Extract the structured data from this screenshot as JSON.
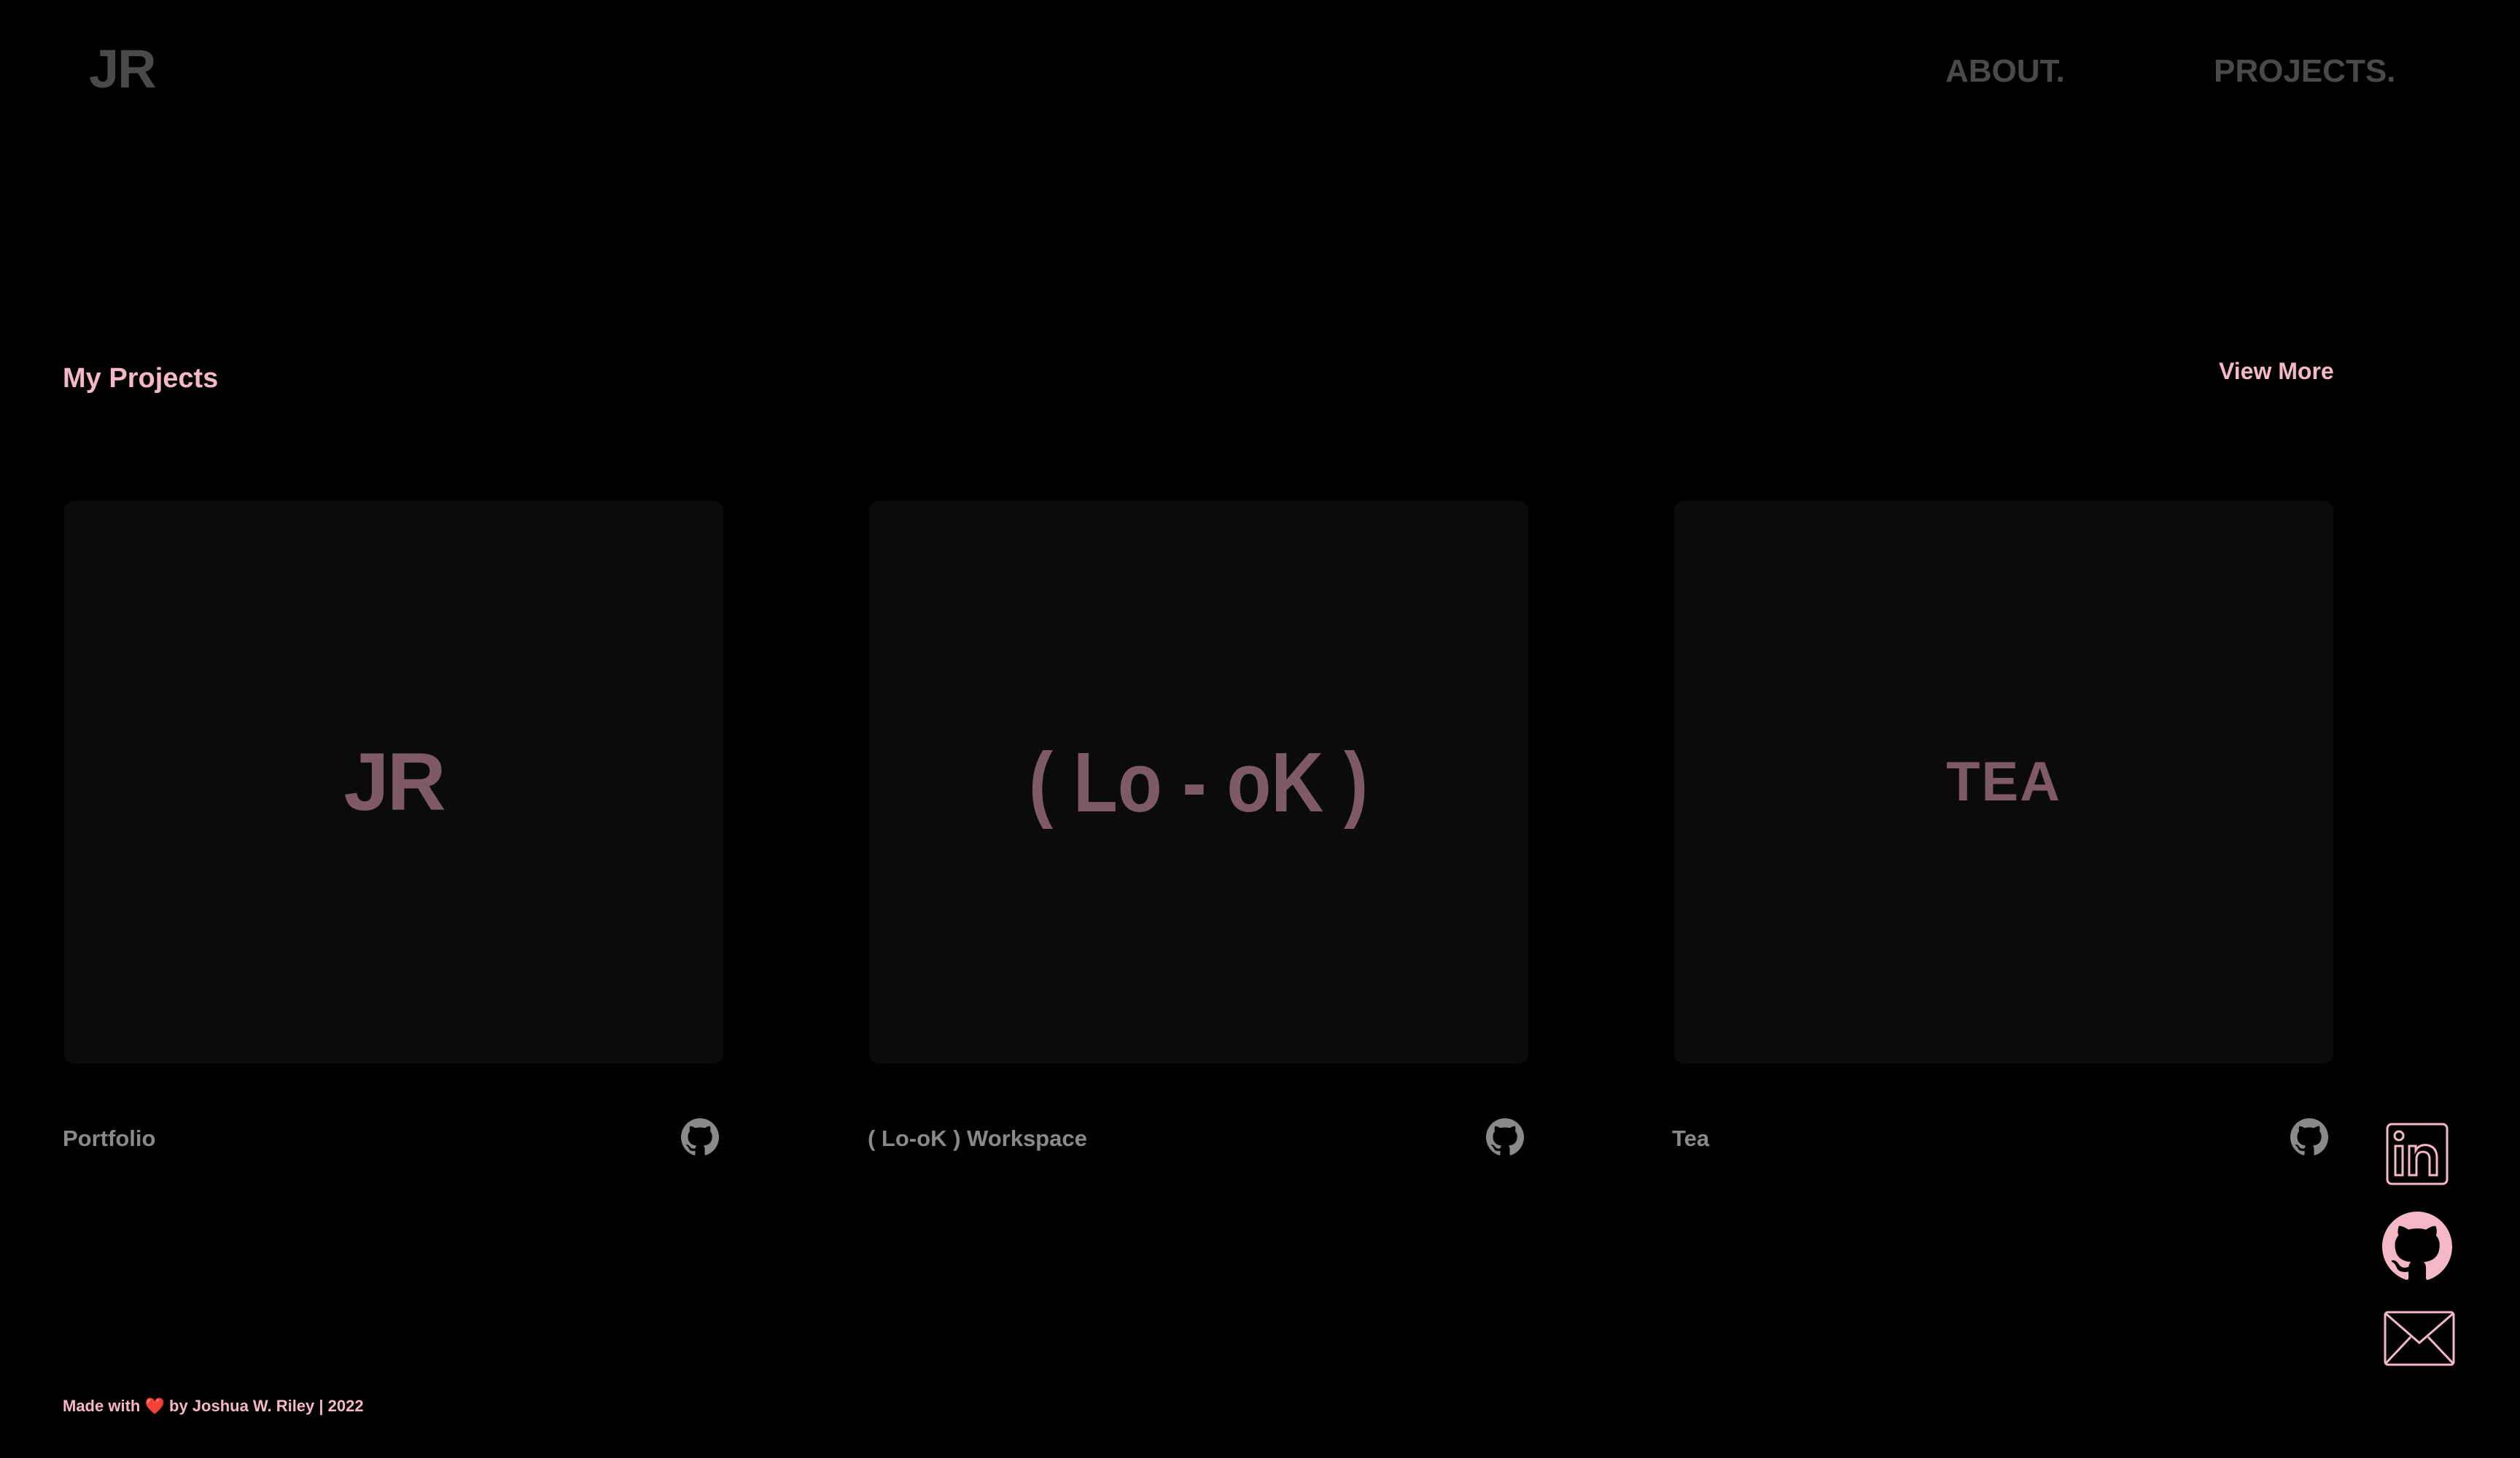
{
  "header": {
    "logo": "JR",
    "nav": [
      {
        "label": "ABOUT."
      },
      {
        "label": "PROJECTS."
      }
    ]
  },
  "projects_section": {
    "title": "My Projects",
    "view_more": "View More",
    "cards": [
      {
        "art_text": "JR",
        "caption": "Portfolio",
        "icon": "github-icon"
      },
      {
        "art_text": "( Lo - oK )",
        "caption": "( Lo-oK ) Workspace",
        "icon": "github-icon"
      },
      {
        "art_text": "TEA",
        "caption": "Tea",
        "icon": "github-icon"
      }
    ]
  },
  "social": [
    {
      "icon": "linkedin-icon"
    },
    {
      "icon": "github-icon"
    },
    {
      "icon": "mail-icon"
    }
  ],
  "footer": {
    "made_with": "Made with",
    "heart": "❤️",
    "by": "by Joshua W. Riley | 2022"
  },
  "colors": {
    "background": "#000000",
    "accent": "#f4b8c6",
    "muted": "#4a4a4a",
    "card": "#0b0b0b",
    "card_art": "#7d5a64",
    "caption": "#8a8a8a"
  }
}
